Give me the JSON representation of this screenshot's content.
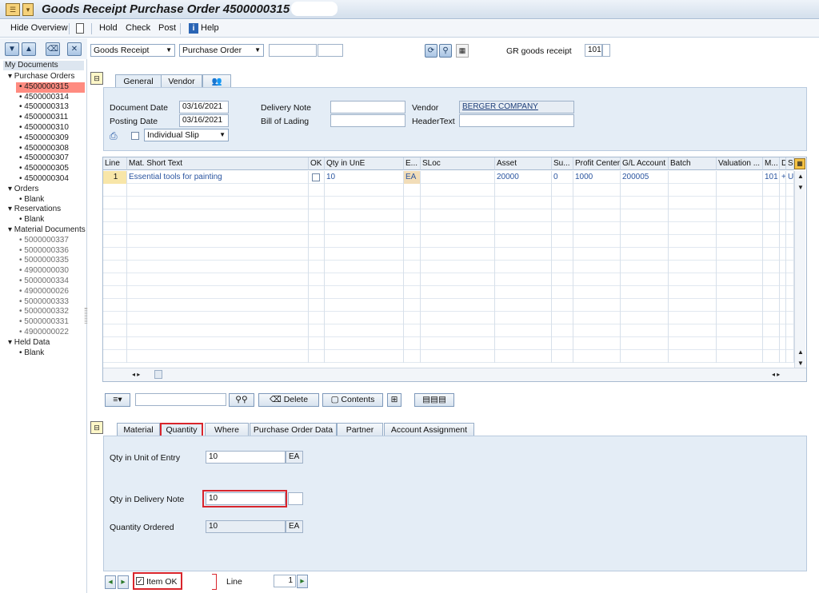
{
  "title": "Goods Receipt Purchase Order 4500000315 -",
  "toolbar": {
    "hide_overview": "Hide Overview",
    "hold": "Hold",
    "check": "Check",
    "post": "Post",
    "help": "Help"
  },
  "tree": {
    "header": "My Documents",
    "lines": [
      {
        "text": "▾ Purchase Orders",
        "lvl": 1,
        "sel": false
      },
      {
        "text": "• 4500000315",
        "lvl": 2,
        "sel": true
      },
      {
        "text": "• 4500000314",
        "lvl": 2,
        "sel": false
      },
      {
        "text": "• 4500000313",
        "lvl": 2,
        "sel": false
      },
      {
        "text": "• 4500000311",
        "lvl": 2,
        "sel": false
      },
      {
        "text": "• 4500000310",
        "lvl": 2,
        "sel": false
      },
      {
        "text": "• 4500000309",
        "lvl": 2,
        "sel": false
      },
      {
        "text": "• 4500000308",
        "lvl": 2,
        "sel": false
      },
      {
        "text": "• 4500000307",
        "lvl": 2,
        "sel": false
      },
      {
        "text": "• 4500000305",
        "lvl": 2,
        "sel": false
      },
      {
        "text": "• 4500000304",
        "lvl": 2,
        "sel": false
      },
      {
        "text": "▾ Orders",
        "lvl": 1,
        "sel": false
      },
      {
        "text": "• Blank",
        "lvl": 2,
        "sel": false
      },
      {
        "text": "▾ Reservations",
        "lvl": 1,
        "sel": false
      },
      {
        "text": "• Blank",
        "lvl": 2,
        "sel": false
      },
      {
        "text": "▾ Material Documents",
        "lvl": 1,
        "sel": false
      },
      {
        "text": "• 5000000337",
        "lvl": 2,
        "sel": false,
        "grey": true
      },
      {
        "text": "• 5000000336",
        "lvl": 2,
        "sel": false,
        "grey": true
      },
      {
        "text": "• 5000000335",
        "lvl": 2,
        "sel": false,
        "grey": true
      },
      {
        "text": "• 4900000030",
        "lvl": 2,
        "sel": false,
        "grey": true
      },
      {
        "text": "• 5000000334",
        "lvl": 2,
        "sel": false,
        "grey": true
      },
      {
        "text": "• 4900000026",
        "lvl": 2,
        "sel": false,
        "grey": true
      },
      {
        "text": "• 5000000333",
        "lvl": 2,
        "sel": false,
        "grey": true
      },
      {
        "text": "• 5000000332",
        "lvl": 2,
        "sel": false,
        "grey": true
      },
      {
        "text": "• 5000000331",
        "lvl": 2,
        "sel": false,
        "grey": true
      },
      {
        "text": "• 4900000022",
        "lvl": 2,
        "sel": false,
        "grey": true
      },
      {
        "text": "▾ Held Data",
        "lvl": 1,
        "sel": false
      },
      {
        "text": "• Blank",
        "lvl": 2,
        "sel": false
      }
    ]
  },
  "selectors": {
    "action": "Goods Receipt",
    "ref": "Purchase Order",
    "gr_label": "GR goods receipt",
    "movement_type": "101"
  },
  "header_tabs": {
    "general": "General",
    "vendor": "Vendor"
  },
  "header": {
    "document_date_label": "Document Date",
    "document_date": "03/16/2021",
    "posting_date_label": "Posting Date",
    "posting_date": "03/16/2021",
    "delivery_note_label": "Delivery Note",
    "bill_of_lading_label": "Bill of Lading",
    "vendor_label": "Vendor",
    "vendor": "BERGER COMPANY",
    "header_text_label": "HeaderText",
    "slip": "Individual Slip"
  },
  "grid": {
    "headers": [
      "Line",
      "Mat. Short Text",
      "OK",
      "Qty in UnE",
      "E...",
      "SLoc",
      "Asset",
      "Su...",
      "Profit Center",
      "G/L Account",
      "Batch",
      "Valuation ...",
      "M...",
      "D",
      "S"
    ],
    "row": {
      "line": "1",
      "text": "Essential tools for painting",
      "qty": "10",
      "unit": "EA",
      "asset": "20000",
      "su": "0",
      "profit_center": "1000",
      "gl": "200005",
      "m": "101",
      "d": "+",
      "s": "U"
    }
  },
  "grid_toolbar": {
    "delete": "Delete",
    "contents": "Contents"
  },
  "item_tabs": {
    "material": "Material",
    "quantity": "Quantity",
    "where": "Where",
    "po_data": "Purchase Order Data",
    "partner": "Partner",
    "account": "Account Assignment"
  },
  "item": {
    "qty_entry_label": "Qty in Unit of Entry",
    "qty_entry": "10",
    "qty_entry_unit": "EA",
    "qty_dn_label": "Qty in Delivery Note",
    "qty_dn": "10",
    "qty_ordered_label": "Quantity Ordered",
    "qty_ordered": "10",
    "qty_ordered_unit": "EA"
  },
  "footer": {
    "item_ok": "Item OK",
    "line_label": "Line",
    "line_value": "1"
  },
  "colors": {
    "selection": "#ff8b80",
    "highlight": "#d9252c",
    "panel": "#e4edf6"
  }
}
